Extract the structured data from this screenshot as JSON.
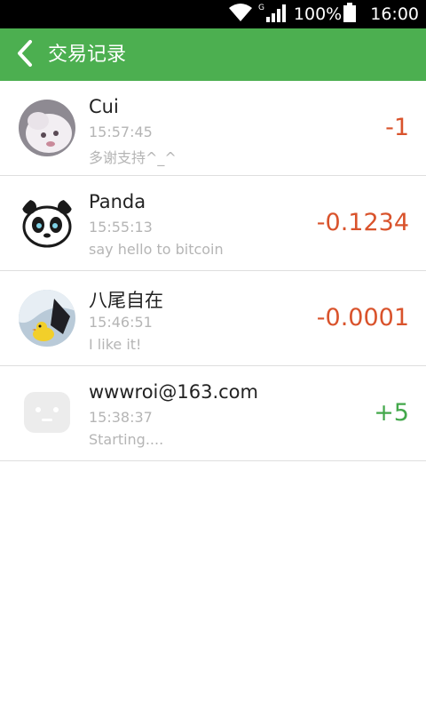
{
  "status_bar": {
    "battery_text": "100%",
    "time": "16:00",
    "network_label": "G",
    "icons": [
      "wifi-icon",
      "signal-icon",
      "battery-icon"
    ]
  },
  "app_bar": {
    "title": "交易记录",
    "back_icon": "chevron-left-icon",
    "color": "#4caf50"
  },
  "transactions": [
    {
      "name": "Cui",
      "time": "15:57:45",
      "message": "多谢支持^_^",
      "amount": "-1",
      "sign": "negative"
    },
    {
      "name": "Panda",
      "time": "15:55:13",
      "message": "say hello to bitcoin",
      "amount": "-0.1234",
      "sign": "negative"
    },
    {
      "name": "八尾自在",
      "time": "15:46:51",
      "message": "I like it!",
      "amount": "-0.0001",
      "sign": "negative"
    },
    {
      "name": "wwwroi@163.com",
      "time": "15:38:37",
      "message": "Starting....",
      "amount": "+5",
      "sign": "positive"
    }
  ],
  "colors": {
    "negative_amount": "#d9532c",
    "positive_amount": "#43a84b",
    "secondary_text": "#b5b5b5"
  }
}
